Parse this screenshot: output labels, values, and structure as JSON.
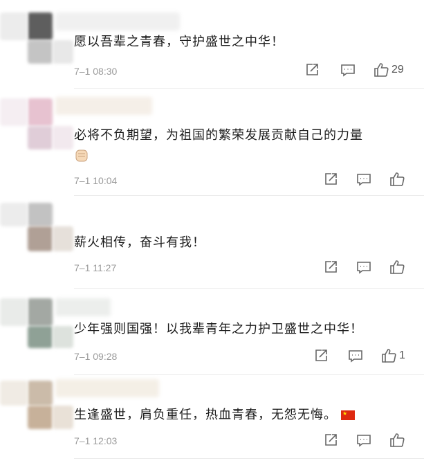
{
  "comments": [
    {
      "text": "愿以吾辈之青春，守护盛世之中华！",
      "time": "7–1 08:30",
      "likes": "29",
      "avatar_colors": [
        "#6b6b6b",
        "#cfcfcf",
        "#dcdcdc",
        "#bdbdbd"
      ]
    },
    {
      "text": "必将不负期望，为祖国的繁荣发展贡献自己的力量",
      "time": "7–1 10:04",
      "likes": "",
      "emoji": "fist-emoji",
      "avatar_colors": [
        "#e8c9d4",
        "#efe2ea",
        "#dcc5d2",
        "#f1e3ec"
      ]
    },
    {
      "text": "薪火相传，奋斗有我！",
      "time": "7–1 11:27",
      "likes": "",
      "avatar_colors": [
        "#c7c7c7",
        "#d6d3d0",
        "#b9aca3",
        "#e3dcd5"
      ]
    },
    {
      "text": "少年强则国强！以我辈青年之力护卫盛世之中华！",
      "time": "7–1 09:28",
      "likes": "1",
      "avatar_colors": [
        "#a8aca8",
        "#c9cec9",
        "#8e9d93",
        "#d9dfd9"
      ]
    },
    {
      "text": "生逢盛世，肩负重任，热血青春，无怨无悔。",
      "time": "7–1 12:03",
      "likes": "",
      "flag": "china-flag-emoji",
      "avatar_colors": [
        "#cdbfb0",
        "#dccfc0",
        "#c6b099",
        "#e6ddd2"
      ]
    }
  ]
}
